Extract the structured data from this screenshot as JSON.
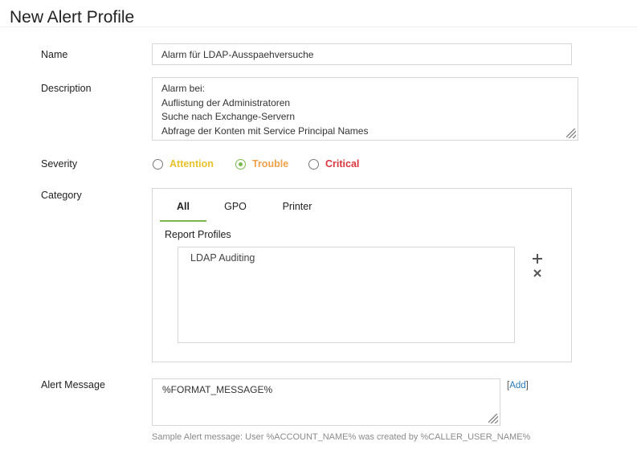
{
  "page": {
    "title": "New Alert Profile"
  },
  "form": {
    "name": {
      "label": "Name",
      "value": "Alarm für LDAP-Ausspaehversuche"
    },
    "description": {
      "label": "Description",
      "lines": [
        "Alarm bei:",
        "Auflistung der Administratoren",
        "Suche nach Exchange-Servern",
        "Abfrage der Konten mit Service Principal Names"
      ]
    },
    "severity": {
      "label": "Severity",
      "options": [
        {
          "label": "Attention",
          "color": "#e8c22b",
          "selected": false
        },
        {
          "label": "Trouble",
          "color": "#f0a04b",
          "selected": true
        },
        {
          "label": "Critical",
          "color": "#d9363e",
          "selected": false
        }
      ]
    },
    "category": {
      "label": "Category",
      "tabs": [
        {
          "label": "All",
          "active": true
        },
        {
          "label": "GPO",
          "active": false
        },
        {
          "label": "Printer",
          "active": false
        }
      ],
      "report_profiles_label": "Report Profiles",
      "report_profiles": [
        "LDAP Auditing"
      ],
      "add_icon": "plus-icon",
      "remove_icon": "close-icon"
    },
    "alert_message": {
      "label": "Alert Message",
      "value": "%FORMAT_MESSAGE%",
      "add_open": "[",
      "add_label": "Add",
      "add_close": "]",
      "sample": "Sample Alert message: User %ACCOUNT_NAME% was created by %CALLER_USER_NAME%"
    }
  },
  "colors": {
    "accent": "#7ab84a",
    "link": "#2a7ab8",
    "border": "#d6d6d6"
  }
}
